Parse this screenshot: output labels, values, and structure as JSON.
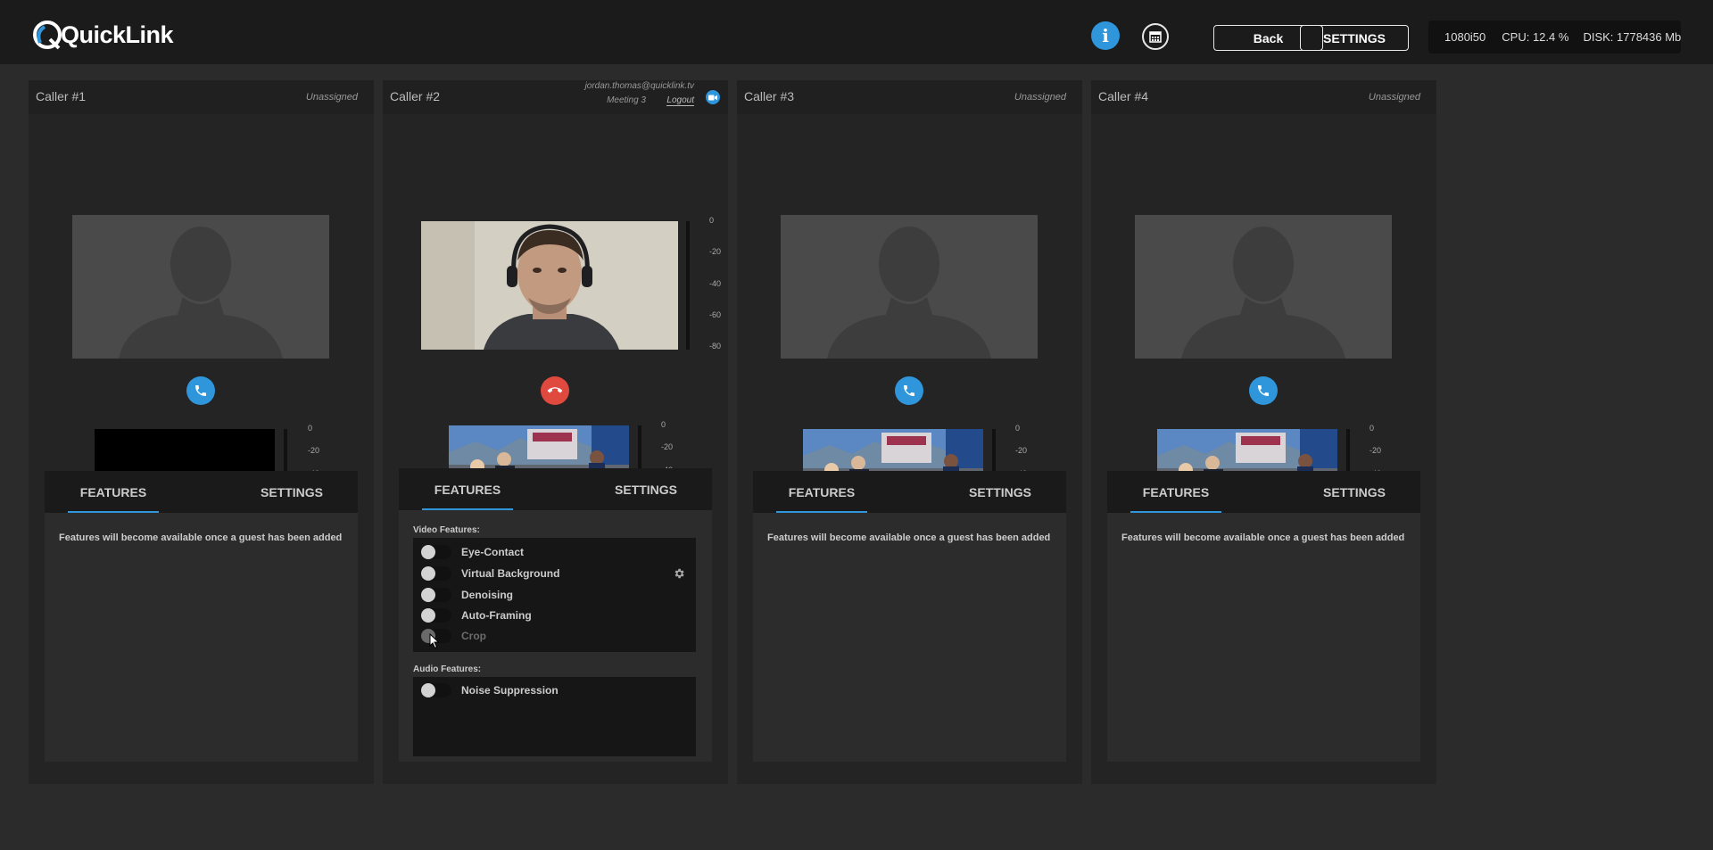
{
  "app": {
    "name": "QuickLink"
  },
  "topbar": {
    "back_label": "Back",
    "settings_label": "SETTINGS",
    "resolution": "1080i50",
    "cpu": "CPU: 12.4 %",
    "disk": "DISK: 1778436 Mb"
  },
  "meter_scale": [
    "0",
    "-20",
    "-40",
    "-60",
    "-80"
  ],
  "callers": [
    {
      "title": "Caller #1",
      "status": "Unassigned",
      "tabs": {
        "features": "FEATURES",
        "settings": "SETTINGS"
      },
      "features_message": "Features will become available once a guest has been added"
    },
    {
      "title": "Caller #2",
      "user_email": "jordan.thomas@quicklink.tv",
      "meeting": "Meeting 3",
      "logout_label": "Logout",
      "tabs": {
        "features": "FEATURES",
        "settings": "SETTINGS"
      },
      "video_features_label": "Video Features:",
      "video_features": [
        "Eye-Contact",
        "Virtual Background",
        "Denoising",
        "Auto-Framing",
        "Crop"
      ],
      "audio_features_label": "Audio Features:",
      "audio_features": [
        "Noise Suppression"
      ]
    },
    {
      "title": "Caller #3",
      "status": "Unassigned",
      "tabs": {
        "features": "FEATURES",
        "settings": "SETTINGS"
      },
      "features_message": "Features will become available once a guest has been added"
    },
    {
      "title": "Caller #4",
      "status": "Unassigned",
      "tabs": {
        "features": "FEATURES",
        "settings": "SETTINGS"
      },
      "features_message": "Features will become available once a guest has been added"
    }
  ],
  "colors": {
    "accent": "#2f96dc",
    "hangup": "#e0493e",
    "meter_level": "#c7d23a"
  },
  "icons": [
    "info-icon",
    "calendar-icon",
    "phone-icon",
    "hangup-icon",
    "video-call-icon",
    "gear-icon",
    "mouse-cursor-icon"
  ]
}
